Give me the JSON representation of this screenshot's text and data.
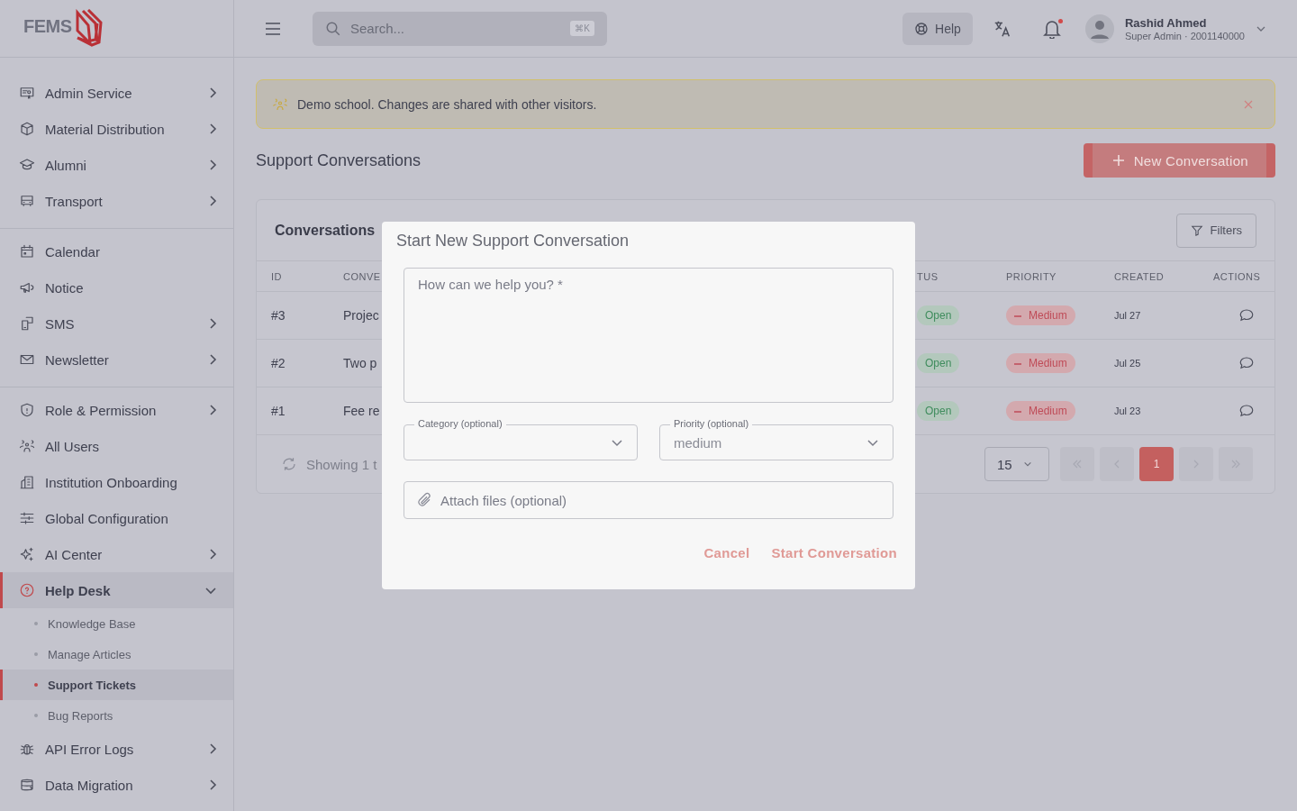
{
  "sidebar": {
    "logo": "FEMS",
    "sections": [
      [
        {
          "kind": "menu",
          "label": "Admin Service",
          "expanded": false,
          "selected": false
        },
        {
          "kind": "menu",
          "label": "Material Distribution",
          "expanded": false,
          "selected": false
        },
        {
          "kind": "menu",
          "label": "Alumni",
          "expanded": false,
          "selected": false
        },
        {
          "kind": "menu",
          "label": "Transport",
          "expanded": false,
          "selected": false
        }
      ],
      [
        {
          "kind": "link",
          "label": "Calendar",
          "selected": false
        },
        {
          "kind": "link",
          "label": "Notice",
          "selected": false
        },
        {
          "kind": "menu",
          "label": "SMS",
          "expanded": false,
          "selected": false
        },
        {
          "kind": "menu",
          "label": "Newsletter",
          "expanded": false,
          "selected": false
        }
      ],
      [
        {
          "kind": "menu",
          "label": "Role & Permission",
          "expanded": false,
          "selected": false
        },
        {
          "kind": "link",
          "label": "All Users",
          "selected": false
        },
        {
          "kind": "link",
          "label": "Institution Onboarding",
          "selected": false
        },
        {
          "kind": "link",
          "label": "Global Configuration",
          "selected": false
        },
        {
          "kind": "menu",
          "label": "AI Center",
          "expanded": false,
          "selected": false
        },
        {
          "kind": "menu",
          "label": "Help Desk",
          "expanded": true,
          "selected": true,
          "children": [
            {
              "label": "Knowledge Base",
              "selected": false
            },
            {
              "label": "Manage Articles",
              "selected": false
            },
            {
              "label": "Support Tickets",
              "selected": true
            },
            {
              "label": "Bug Reports",
              "selected": false
            }
          ]
        },
        {
          "kind": "menu",
          "label": "API Error Logs",
          "expanded": false,
          "selected": false
        },
        {
          "kind": "menu",
          "label": "Data Migration",
          "expanded": false,
          "selected": false
        }
      ]
    ]
  },
  "topbar": {
    "search": {
      "placeholder": "Search...",
      "shortcut": "⌘K"
    },
    "help": "Help",
    "has_unread": true,
    "user": {
      "name": "Rashid Ahmed",
      "role": "Super Admin · 2001140000"
    }
  },
  "banner": {
    "text": "Demo school. Changes are shared with other visitors."
  },
  "page": {
    "title": "Support Conversations",
    "new_button": "New Conversation"
  },
  "card": {
    "title": "Conversations",
    "filters": "Filters",
    "columns": [
      "ID",
      "CONVE",
      "TUS",
      "PRIORITY",
      "CREATED",
      "ACTIONS"
    ],
    "rows": [
      {
        "id": "#3",
        "preview": "Projec",
        "status": "Open",
        "priority": "Medium",
        "created": "Jul 27"
      },
      {
        "id": "#2",
        "preview": "Two p",
        "status": "Open",
        "priority": "Medium",
        "created": "Jul 25"
      },
      {
        "id": "#1",
        "preview": "Fee re",
        "status": "Open",
        "priority": "Medium",
        "created": "Jul 23"
      }
    ],
    "footer": "Showing 1 t",
    "page_size": "15",
    "pages": [
      {
        "label": "1",
        "selected": true
      }
    ]
  },
  "modal": {
    "title": "Start New Support Conversation",
    "message": {
      "placeholder": "How can we help you? *"
    },
    "category": {
      "label": "Category (optional)"
    },
    "priority": {
      "label": "Priority (optional)",
      "value": "medium"
    },
    "attach": "Attach files (optional)",
    "cancel": "Cancel",
    "submit": "Start Conversation"
  }
}
